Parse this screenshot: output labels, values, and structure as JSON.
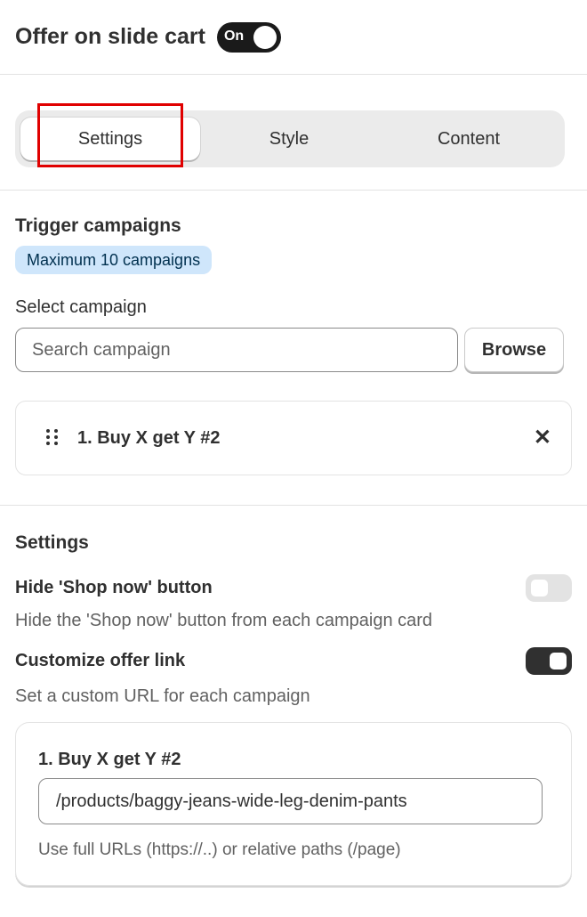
{
  "header": {
    "title": "Offer on slide cart",
    "toggle_label": "On"
  },
  "tabs": [
    {
      "label": "Settings",
      "active": true
    },
    {
      "label": "Style",
      "active": false
    },
    {
      "label": "Content",
      "active": false
    }
  ],
  "trigger": {
    "title": "Trigger campaigns",
    "badge": "Maximum 10 campaigns",
    "select_label": "Select campaign",
    "search_placeholder": "Search campaign",
    "browse_label": "Browse",
    "campaigns": [
      {
        "name": "1. Buy X get Y #2"
      }
    ]
  },
  "settings": {
    "title": "Settings",
    "hide_shop_now": {
      "label": "Hide 'Shop now' button",
      "help": "Hide the 'Shop now' button from each campaign card",
      "enabled": false
    },
    "customize_link": {
      "label": "Customize offer link",
      "help": "Set a custom URL for each campaign",
      "enabled": true
    },
    "link_card": {
      "title": "1. Buy X get Y #2",
      "url_value": "/products/baggy-jeans-wide-leg-denim-pants",
      "help": "Use full URLs (https://..) or relative paths (/page)"
    }
  },
  "colors": {
    "highlight": "#e00000",
    "badge_bg": "#cfe6fb",
    "toggle_on": "#1a1a1a"
  }
}
